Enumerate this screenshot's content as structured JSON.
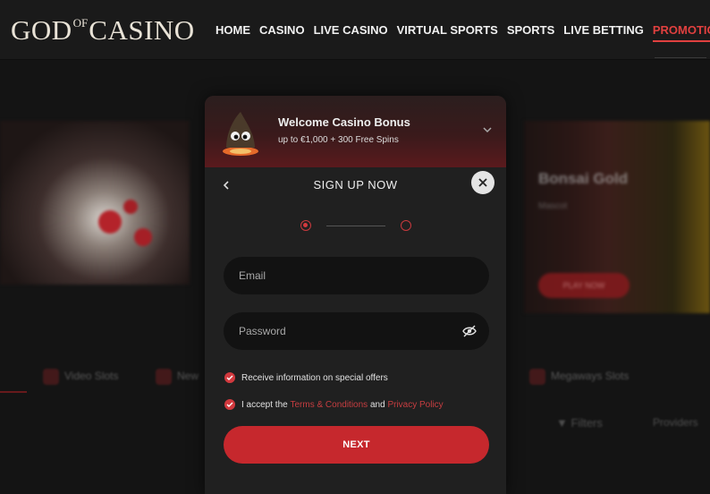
{
  "header": {
    "logo": {
      "part1": "GOD",
      "part2": "OF",
      "part3": "CASINO"
    },
    "nav": [
      {
        "label": "HOME"
      },
      {
        "label": "CASINO"
      },
      {
        "label": "LIVE CASINO"
      },
      {
        "label": "VIRTUAL SPORTS"
      },
      {
        "label": "SPORTS"
      },
      {
        "label": "LIVE BETTING"
      },
      {
        "label": "PROMOTIONS",
        "active": true
      }
    ]
  },
  "background": {
    "featured_game_title": "Bonsai Gold",
    "featured_game_sub": "Mascot",
    "play_now_label": "PLAY NOW",
    "categories": [
      "Video Slots",
      "New",
      "Megaways Slots"
    ],
    "filters_label": "Filters",
    "providers_label": "Providers"
  },
  "modal": {
    "promo": {
      "title": "Welcome Casino Bonus",
      "subtitle": "up to €1,000 + 300 Free Spins"
    },
    "title": "SIGN UP NOW",
    "stepper": {
      "current": 1,
      "total": 2
    },
    "email": {
      "placeholder": "Email",
      "value": ""
    },
    "password": {
      "placeholder": "Password",
      "value": ""
    },
    "checkboxes": {
      "offers": {
        "label": "Receive information on special offers",
        "checked": true
      },
      "terms": {
        "prefix": "I accept the ",
        "terms_link": "Terms & Conditions",
        "middle": " and ",
        "privacy_link": "Privacy Policy",
        "checked": true
      }
    },
    "next_label": "NEXT"
  },
  "colors": {
    "accent": "#c6282d",
    "link": "#c63d40",
    "active_nav": "#e0403f",
    "modal_bg": "#202020",
    "field_bg": "#121212"
  },
  "icons": [
    "back-arrow-icon",
    "close-icon",
    "chevron-down-icon",
    "eye-off-icon",
    "check-icon",
    "mascot-icon"
  ]
}
